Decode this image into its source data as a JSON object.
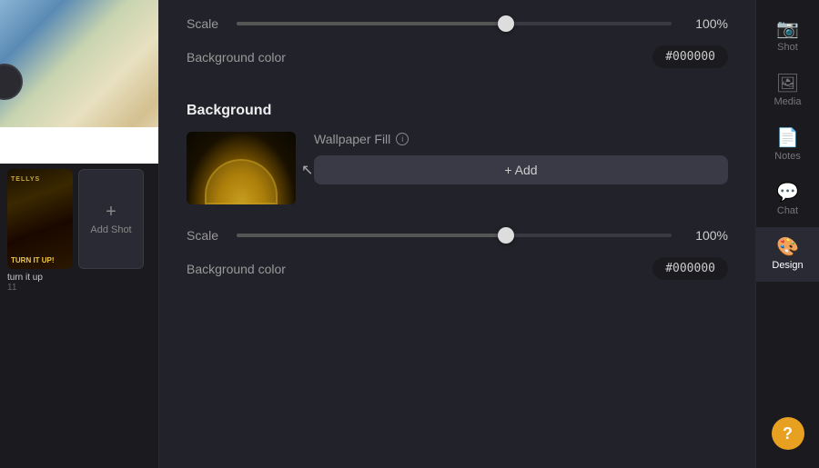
{
  "left_panel": {
    "shot_name": "turn it up",
    "shot_number": "11",
    "add_shot_label": "Add Shot",
    "shot_top_label": "Shot"
  },
  "main_panel": {
    "scale_label": "Scale",
    "scale_value_1": "100%",
    "scale_value_2": "100%",
    "bg_color_label": "Background color",
    "bg_color_value_1": "#000000",
    "bg_color_value_2": "#000000",
    "background_label": "Background",
    "wallpaper_fill_label": "Wallpaper Fill",
    "add_button_label": "+ Add",
    "slider1_fill_pct": 62,
    "slider1_thumb_pct": 62,
    "slider2_fill_pct": 62,
    "slider2_thumb_pct": 62
  },
  "right_sidebar": {
    "items": [
      {
        "id": "shot",
        "label": "Shot",
        "icon": "📷"
      },
      {
        "id": "media",
        "label": "Media",
        "icon": "🖼"
      },
      {
        "id": "notes",
        "label": "Notes",
        "icon": "📄"
      },
      {
        "id": "chat",
        "label": "Chat",
        "icon": "💬"
      },
      {
        "id": "design",
        "label": "Design",
        "icon": "🎨"
      }
    ],
    "help_label": "?"
  }
}
